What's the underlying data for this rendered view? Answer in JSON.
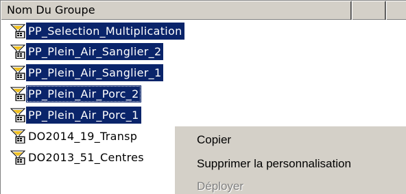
{
  "columns": {
    "name": "Nom Du Groupe",
    "col2": "",
    "col3": ""
  },
  "groups": [
    {
      "label": "PP_Selection_Multiplication",
      "selected": true,
      "icon": "group-icon"
    },
    {
      "label": "PP_Plein_Air_Sanglier_2",
      "selected": true,
      "icon": "group-icon"
    },
    {
      "label": "PP_Plein_Air_Sanglier_1",
      "selected": true,
      "icon": "group-icon"
    },
    {
      "label": "PP_Plein_Air_Porc_2",
      "selected": true,
      "focused": true,
      "icon": "group-icon"
    },
    {
      "label": "PP_Plein_Air_Porc_1",
      "selected": true,
      "icon": "group-icon"
    },
    {
      "label": "DO2014_19_Transp",
      "selected": false,
      "icon": "group-icon"
    },
    {
      "label": "DO2013_51_Centres",
      "selected": false,
      "icon": "group-icon"
    }
  ],
  "context_menu": {
    "items": [
      {
        "label": "Copier",
        "disabled": false
      },
      {
        "label": "Supprimer la personnalisation",
        "disabled": false
      },
      {
        "label": "Déployer",
        "disabled": true
      }
    ]
  },
  "colors": {
    "selection": "#0a246a",
    "menu_bg": "#d4d0c8",
    "disabled_text": "#808080"
  }
}
